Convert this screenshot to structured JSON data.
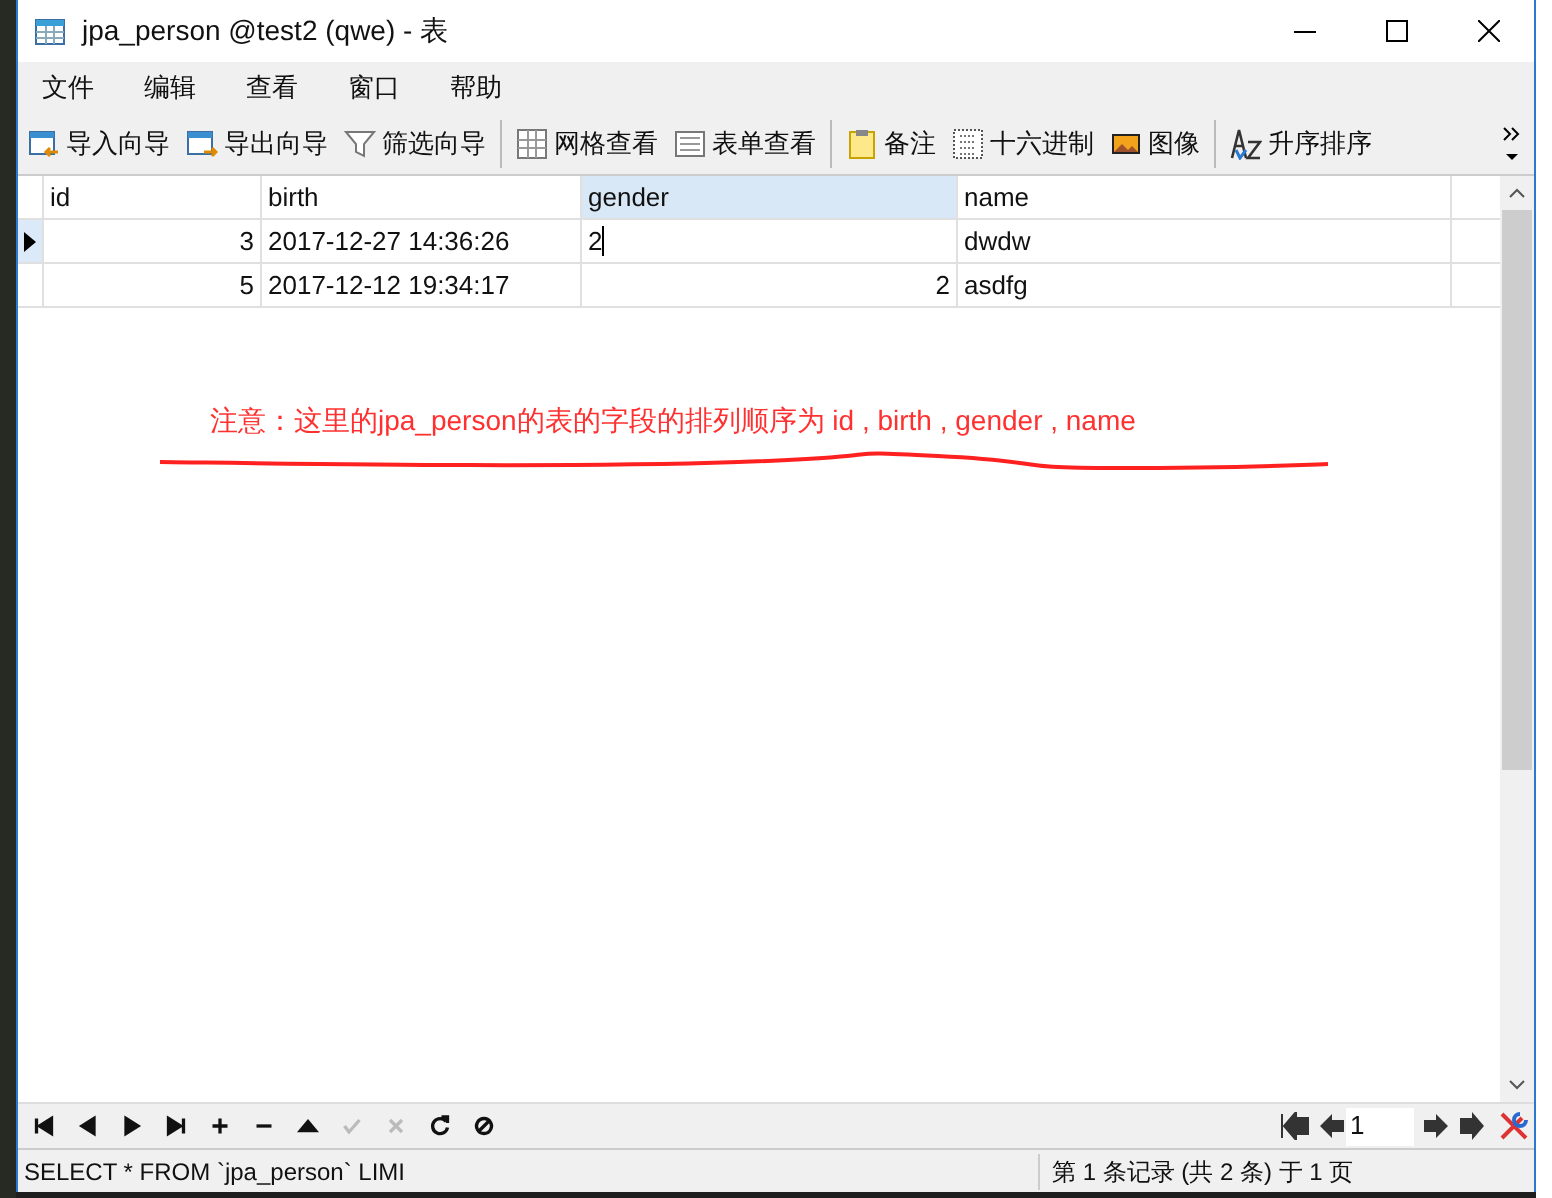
{
  "window": {
    "title": "jpa_person @test2 (qwe) - 表"
  },
  "menu": [
    "文件",
    "编辑",
    "查看",
    "窗口",
    "帮助"
  ],
  "toolbar": [
    [
      {
        "kind": "import",
        "label": "导入向导"
      },
      {
        "kind": "export",
        "label": "导出向导"
      },
      {
        "kind": "filter",
        "label": "筛选向导"
      }
    ],
    [
      {
        "kind": "grid",
        "label": "网格查看"
      },
      {
        "kind": "form",
        "label": "表单查看"
      }
    ],
    [
      {
        "kind": "note",
        "label": "备注"
      },
      {
        "kind": "hex",
        "label": "十六进制"
      },
      {
        "kind": "image",
        "label": "图像"
      }
    ],
    [
      {
        "kind": "sort",
        "label": "升序排序"
      }
    ]
  ],
  "table": {
    "columns": [
      {
        "label": "id",
        "kind": "number",
        "selected": false
      },
      {
        "label": "birth",
        "kind": "text",
        "selected": false
      },
      {
        "label": "gender",
        "kind": "number",
        "selected": true
      },
      {
        "label": "name",
        "kind": "text",
        "selected": false
      }
    ],
    "rows": [
      {
        "selected": true,
        "cells": [
          {
            "text": "3",
            "editing": false
          },
          {
            "text": "2017-12-27 14:36:26",
            "editing": false
          },
          {
            "text": "2",
            "editing": true
          },
          {
            "text": "dwdw",
            "editing": false
          }
        ]
      },
      {
        "selected": false,
        "cells": [
          {
            "text": "5",
            "editing": false
          },
          {
            "text": "2017-12-12 19:34:17",
            "editing": false
          },
          {
            "text": "2",
            "editing": false
          },
          {
            "text": "asdfg",
            "editing": false
          }
        ]
      }
    ]
  },
  "annotation": "注意：这里的jpa_person的表的字段的排列顺序为 id , birth , gender , name",
  "nav": {
    "buttons": [
      {
        "kind": "first",
        "disabled": false
      },
      {
        "kind": "prev",
        "disabled": false
      },
      {
        "kind": "next",
        "disabled": false
      },
      {
        "kind": "last",
        "disabled": false
      },
      {
        "kind": "add",
        "disabled": false
      },
      {
        "kind": "delete",
        "disabled": false
      },
      {
        "kind": "up",
        "disabled": false
      },
      {
        "kind": "apply",
        "disabled": true
      },
      {
        "kind": "cancel",
        "disabled": true
      },
      {
        "kind": "refresh",
        "disabled": false
      },
      {
        "kind": "stop",
        "disabled": false
      }
    ],
    "page": "1"
  },
  "status_bar": {
    "sql": "SELECT * FROM `jpa_person` LIMI",
    "records": "第 1 条记录 (共 2 条) 于 1 页"
  }
}
